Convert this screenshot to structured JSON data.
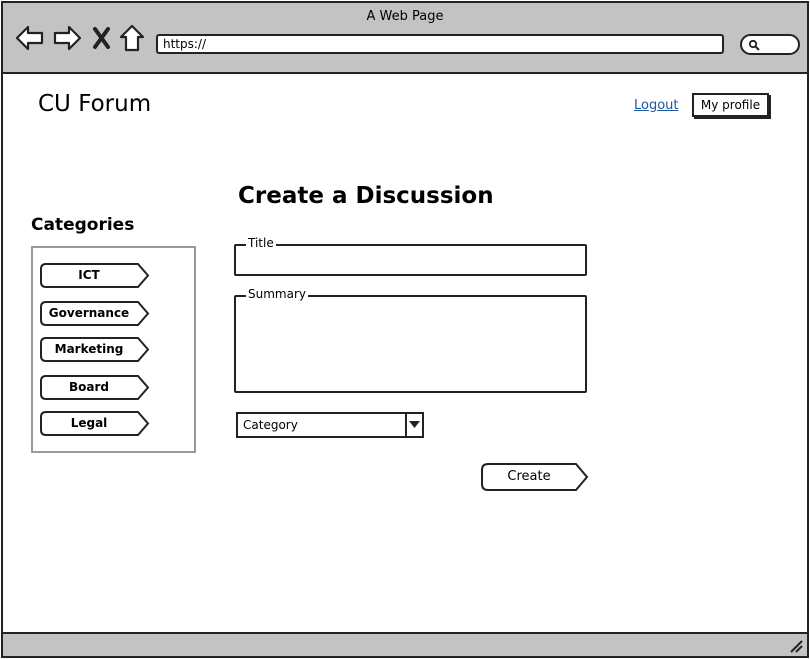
{
  "browser": {
    "window_title": "A Web Page",
    "url": "https://",
    "icons": {
      "back": "arrow-left-icon",
      "forward": "arrow-right-icon",
      "stop": "close-icon",
      "home": "home-icon",
      "search": "search-icon",
      "resize": "resize-grip-icon"
    }
  },
  "header": {
    "brand": "CU Forum",
    "logout_label": "Logout",
    "profile_label": "My profile",
    "link_color": "#1a5a9e"
  },
  "sidebar": {
    "title": "Categories",
    "items": [
      {
        "label": "ICT"
      },
      {
        "label": "Governance"
      },
      {
        "label": "Marketing"
      },
      {
        "label": "Board"
      },
      {
        "label": "Legal"
      }
    ]
  },
  "form": {
    "heading": "Create a Discussion",
    "title_legend": "Title",
    "title_value": "",
    "summary_legend": "Summary",
    "summary_value": "",
    "category_selected": "Category",
    "submit_label": "Create"
  }
}
